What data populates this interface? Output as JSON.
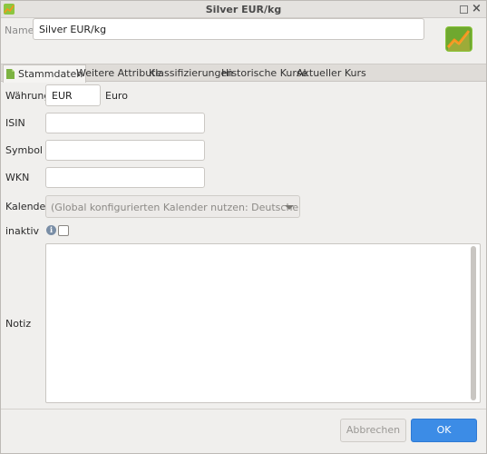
{
  "window": {
    "title": "Silver EUR/kg"
  },
  "name_row": {
    "label": "Name",
    "value": "Silver EUR/kg"
  },
  "tabs": [
    {
      "label": "Stammdaten",
      "active": true
    },
    {
      "label": "Weitere Attribute",
      "active": false
    },
    {
      "label": "Klassifizierungen",
      "active": false
    },
    {
      "label": "Historische Kurse",
      "active": false
    },
    {
      "label": "Aktueller Kurs",
      "active": false
    }
  ],
  "form": {
    "currency_label": "Währung",
    "currency_code": "EUR",
    "currency_name": "Euro",
    "isin_label": "ISIN",
    "isin_value": "",
    "symbol_label": "Symbol",
    "symbol_value": "",
    "wkn_label": "WKN",
    "wkn_value": "",
    "calendar_label": "Kalender",
    "calendar_value": "(Global konfigurierten Kalender nutzen: Deutsche Börsen)",
    "inactive_label": "inaktiv",
    "inactive_checked": false,
    "note_label": "Notiz",
    "note_value": ""
  },
  "buttons": {
    "cancel": "Abbrechen",
    "ok": "OK"
  },
  "colors": {
    "accent": "#3c8ce6",
    "window_bg": "#f0efed"
  },
  "icons": {
    "app": "portfolio-chart-icon",
    "info": "info-icon",
    "tab": "document-icon"
  }
}
